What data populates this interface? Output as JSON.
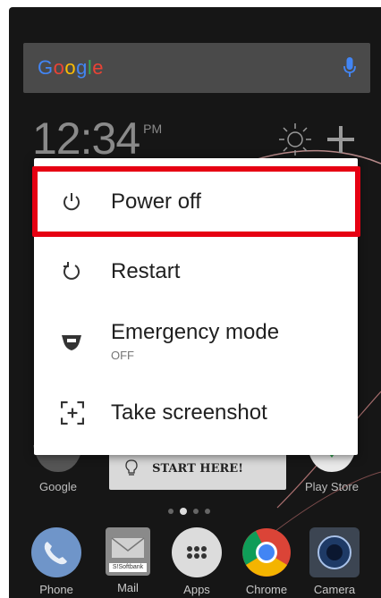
{
  "search": {
    "logo_text": [
      "G",
      "o",
      "o",
      "g",
      "l",
      "e"
    ],
    "logo_colors": [
      "#4285F4",
      "#EA4335",
      "#FBBC05",
      "#4285F4",
      "#34A853",
      "#EA4335"
    ]
  },
  "clock": {
    "time": "12:34",
    "ampm": "PM"
  },
  "power_menu": {
    "items": [
      {
        "label": "Power off",
        "sub": ""
      },
      {
        "label": "Restart",
        "sub": ""
      },
      {
        "label": "Emergency mode",
        "sub": "OFF"
      },
      {
        "label": "Take screenshot",
        "sub": ""
      }
    ],
    "highlight_color": "#e60012"
  },
  "home": {
    "widget_text": "START HERE!",
    "left_app_label": "Google",
    "right_app_label": "Play Store",
    "page_indicator": {
      "pages": 4,
      "current": 2
    }
  },
  "dock": {
    "items": [
      {
        "label": "Phone",
        "icon": "phone-icon"
      },
      {
        "label": "Mail",
        "icon": "mail-icon",
        "badge_text": "S!Softbank"
      },
      {
        "label": "Apps",
        "icon": "apps-grid-icon"
      },
      {
        "label": "Chrome",
        "icon": "chrome-icon"
      },
      {
        "label": "Camera",
        "icon": "camera-icon"
      }
    ]
  }
}
